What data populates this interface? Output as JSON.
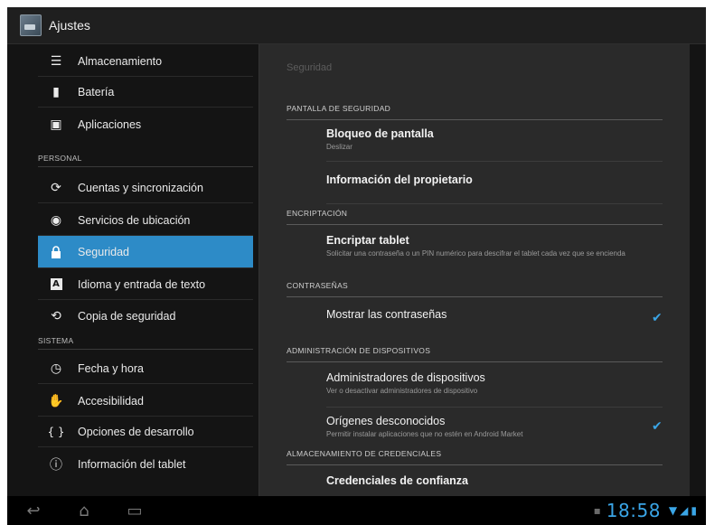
{
  "actionbar": {
    "title": "Ajustes"
  },
  "sidebar": {
    "items": [
      {
        "label": "Almacenamiento",
        "icon": "storage-icon",
        "glyph": "☰"
      },
      {
        "label": "Batería",
        "icon": "battery-icon",
        "glyph": "▮"
      },
      {
        "label": "Aplicaciones",
        "icon": "apps-icon",
        "glyph": "▣"
      },
      {
        "label": "Cuentas y sincronización",
        "icon": "sync-icon",
        "glyph": "⟳"
      },
      {
        "label": "Servicios de ubicación",
        "icon": "location-icon",
        "glyph": "◉"
      },
      {
        "label": "Seguridad",
        "icon": "lock-icon",
        "glyph": "🔒"
      },
      {
        "label": "Idioma y entrada de texto",
        "icon": "language-icon",
        "glyph": "A"
      },
      {
        "label": "Copia de seguridad",
        "icon": "backup-icon",
        "glyph": "⟲"
      },
      {
        "label": "Fecha y hora",
        "icon": "clock-icon",
        "glyph": "◷"
      },
      {
        "label": "Accesibilidad",
        "icon": "accessibility-icon",
        "glyph": "✋"
      },
      {
        "label": "Opciones de desarrollo",
        "icon": "developer-icon",
        "glyph": "{ }"
      },
      {
        "label": "Información del tablet",
        "icon": "info-icon",
        "glyph": "ⓘ"
      }
    ],
    "headers": {
      "personal": "PERSONAL",
      "sistema": "SISTEMA"
    }
  },
  "panel": {
    "title": "Seguridad",
    "sections": {
      "pantalla": "PANTALLA DE SEGURIDAD",
      "encriptacion": "ENCRIPTACIÓN",
      "contrasenas": "CONTRASEÑAS",
      "administracion": "ADMINISTRACIÓN DE DISPOSITIVOS",
      "credenciales": "ALMACENAMIENTO DE CREDENCIALES"
    },
    "rows": {
      "bloqueo": {
        "title": "Bloqueo de pantalla",
        "summary": "Deslizar"
      },
      "propietario": {
        "title": "Información del propietario"
      },
      "encriptar": {
        "title": "Encriptar tablet",
        "summary": "Solicitar una contraseña o un PIN numérico para descifrar el tablet cada vez que se encienda"
      },
      "mostrar": {
        "title": "Mostrar las contraseñas",
        "checked": true
      },
      "administradores": {
        "title": "Administradores de dispositivos",
        "summary": "Ver o desactivar administradores de dispositivo"
      },
      "origenes": {
        "title": "Orígenes desconocidos",
        "summary": "Permitir instalar aplicaciones que no estén en Android Market",
        "checked": true
      },
      "credenciales": {
        "title": "Credenciales de confianza"
      }
    },
    "check_glyph": "✔"
  },
  "systembar": {
    "back_glyph": "↩",
    "home_glyph": "⌂",
    "recents_glyph": "▭",
    "time": "18:58",
    "wifi_glyph": "▼",
    "signal_glyph": "◢",
    "battery_glyph": "▮",
    "notification_glyph": "▪"
  },
  "colors": {
    "accent": "#2d8bc7",
    "check": "#3aa5e6"
  }
}
